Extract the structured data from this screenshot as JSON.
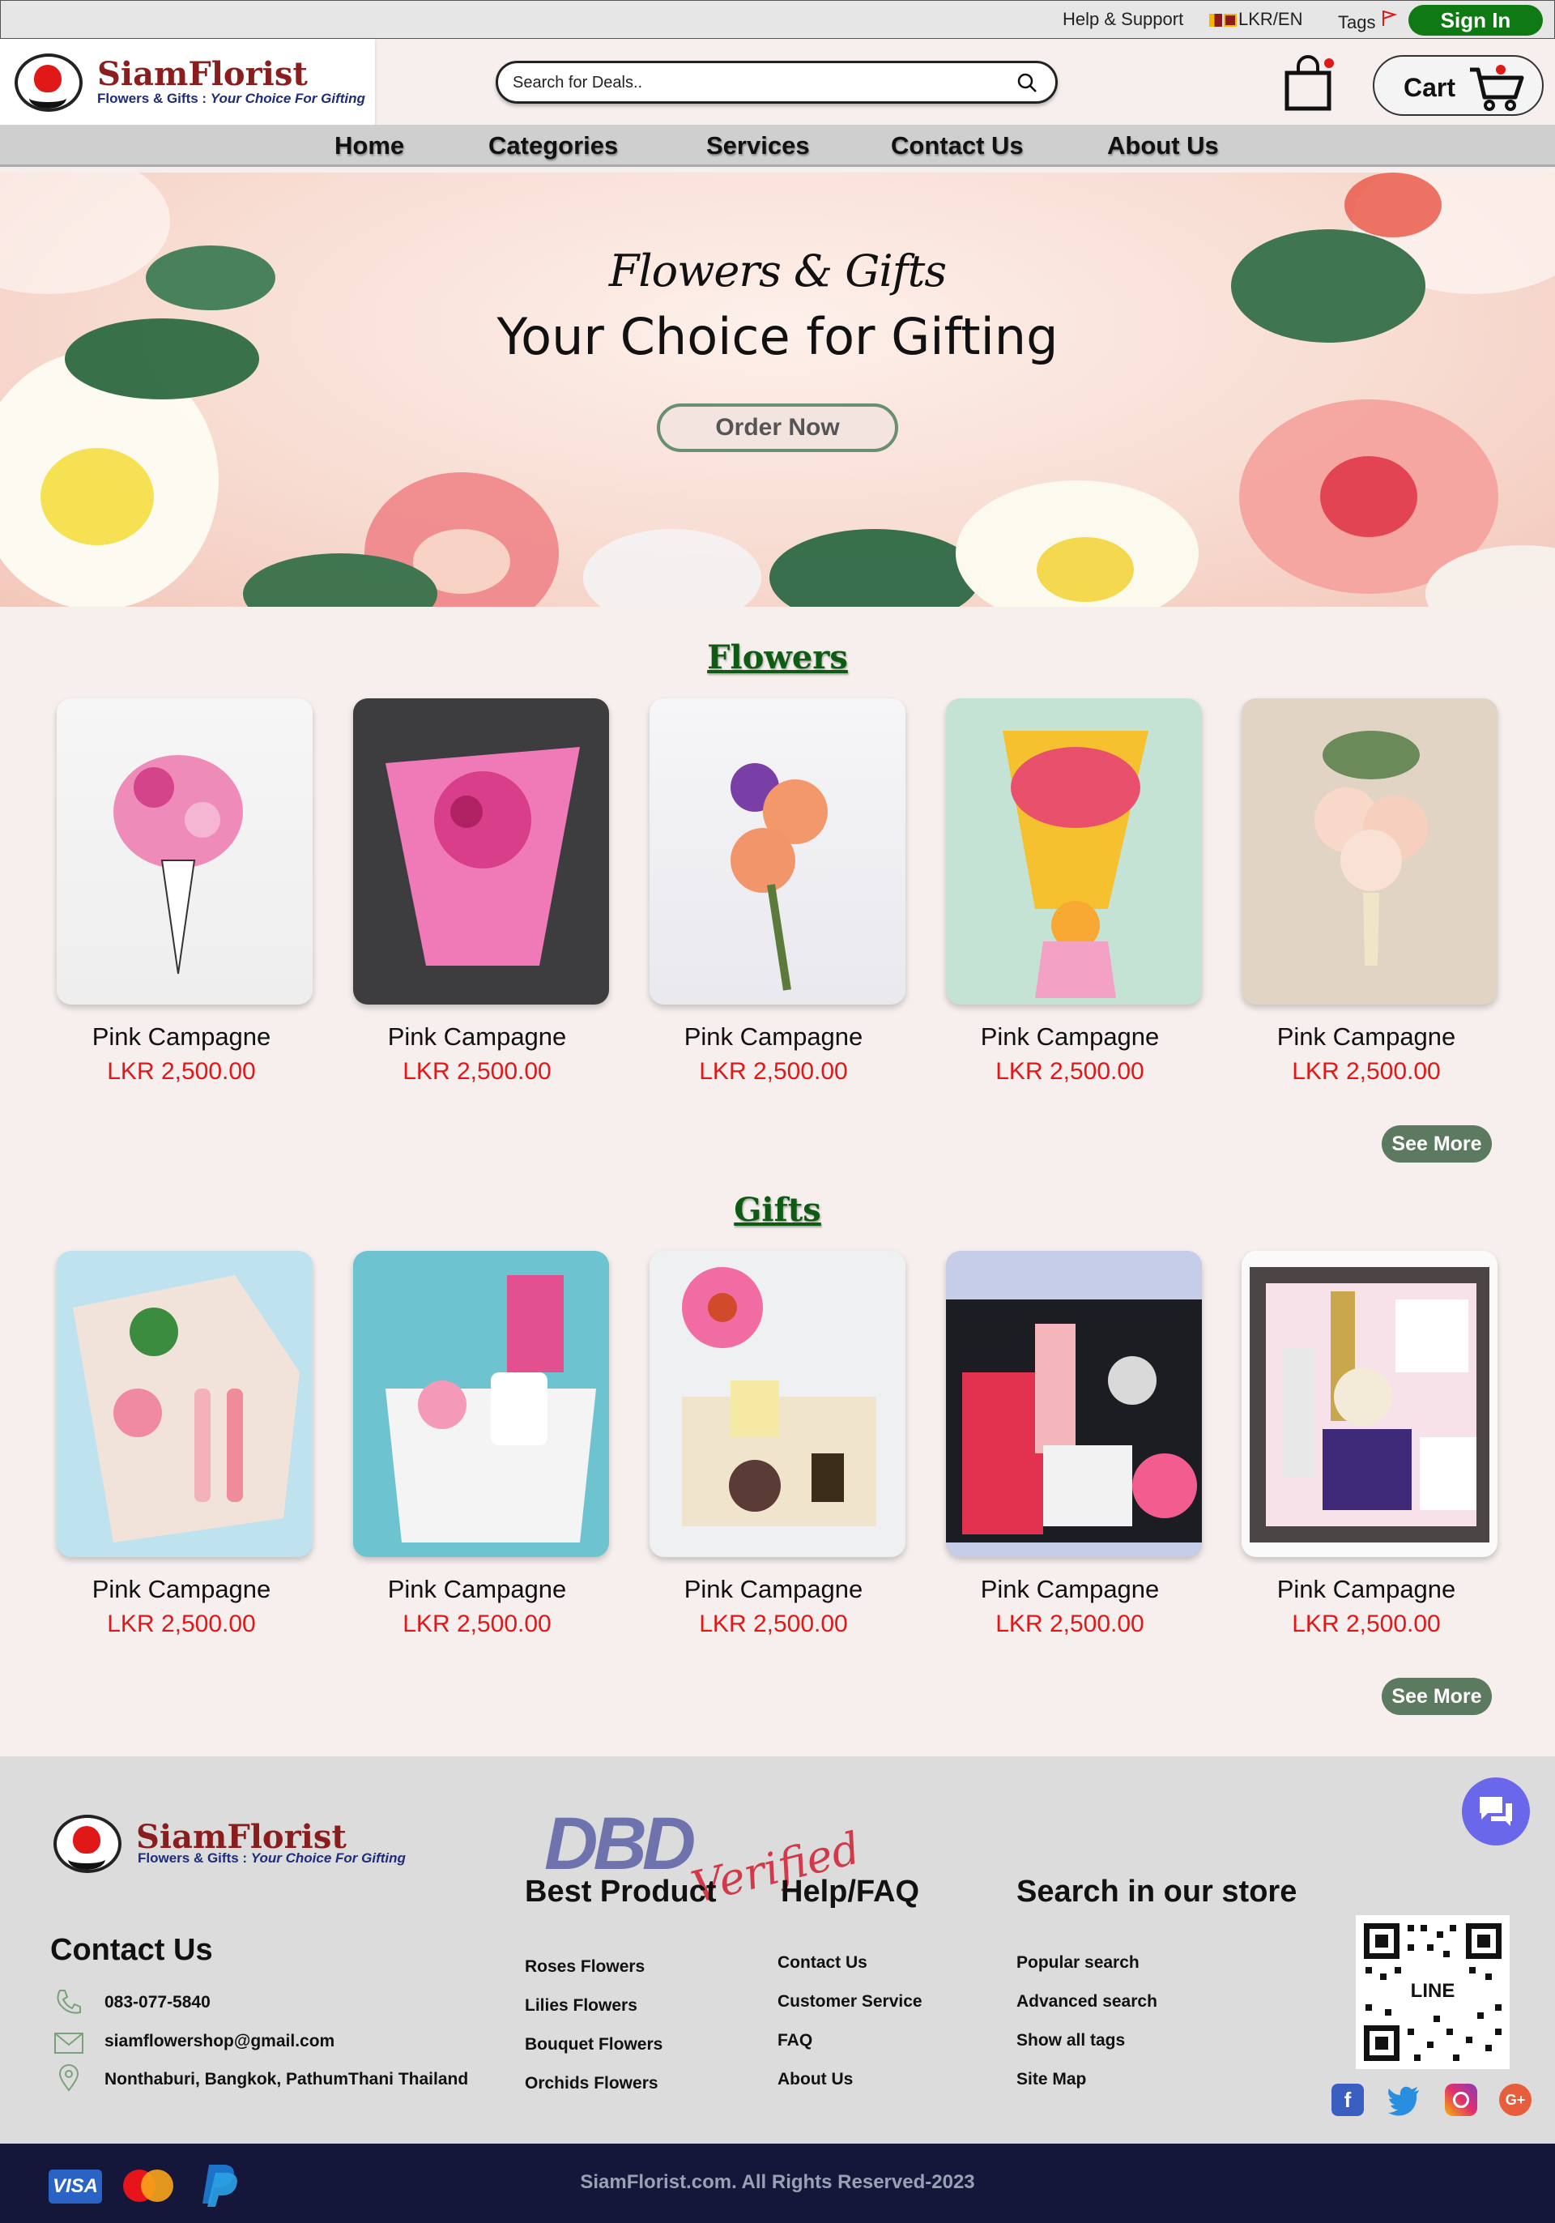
{
  "topbar": {
    "help": "Help & Support",
    "currency": "LKR/EN",
    "tags": "Tags",
    "signin": "Sign In"
  },
  "brand": {
    "name": "SiamFlorist",
    "tagline_prefix": "Flowers & Gifts : ",
    "tagline_italic": "Your Choice For Gifting"
  },
  "search": {
    "placeholder": "Search for Deals.."
  },
  "cart": {
    "label": "Cart"
  },
  "nav": [
    "Home",
    "Categories",
    "Services",
    "Contact Us",
    "About Us"
  ],
  "hero": {
    "kicker": "Flowers & Gifts",
    "title": "Your Choice for Gifting",
    "cta": "Order Now"
  },
  "flowers": {
    "title": "Flowers",
    "products": [
      {
        "name": "Pink Campagne",
        "price": "LKR 2,500.00"
      },
      {
        "name": "Pink Campagne",
        "price": "LKR 2,500.00"
      },
      {
        "name": "Pink Campagne",
        "price": "LKR 2,500.00"
      },
      {
        "name": "Pink Campagne",
        "price": "LKR 2,500.00"
      },
      {
        "name": "Pink Campagne",
        "price": "LKR 2,500.00"
      }
    ],
    "see_more": "See More"
  },
  "gifts": {
    "title": "Gifts",
    "products": [
      {
        "name": "Pink Campagne",
        "price": "LKR 2,500.00"
      },
      {
        "name": "Pink Campagne",
        "price": "LKR 2,500.00"
      },
      {
        "name": "Pink Campagne",
        "price": "LKR 2,500.00"
      },
      {
        "name": "Pink Campagne",
        "price": "LKR 2,500.00"
      },
      {
        "name": "Pink Campagne",
        "price": "LKR 2,500.00"
      }
    ],
    "see_more": "See More"
  },
  "footer": {
    "contact": {
      "title": "Contact Us",
      "phone": "083-077-5840",
      "email": "siamflowershop@gmail.com",
      "address": "Nonthaburi, Bangkok, PathumThani Thailand"
    },
    "dbd": {
      "logo": "DBD",
      "script": "Verified"
    },
    "best_product": {
      "title": "Best Product",
      "links": [
        "Roses Flowers",
        "Lilies Flowers",
        "Bouquet Flowers",
        "Orchids Flowers"
      ]
    },
    "help": {
      "title": "Help/FAQ",
      "links": [
        "Contact Us",
        "Customer Service",
        "FAQ",
        "About Us"
      ]
    },
    "store": {
      "title": "Search in our store",
      "links": [
        "Popular search",
        "Advanced search",
        "Show all tags",
        "Site Map"
      ]
    },
    "qr_label": "LINE",
    "social": {
      "facebook": "f",
      "google": "G+"
    },
    "payments": {
      "visa": "VISA"
    },
    "copyright": "SiamFlorist.com. All Rights Reserved-2023"
  },
  "colors": {
    "brand_green": "#0f7a14",
    "section_title": "#0e5c13",
    "price_red": "#e01818",
    "see_more": "#5c7a5f",
    "footer_bg": "#dcdcdc",
    "bottom_bar": "#14163a"
  },
  "icons": [
    "search-icon",
    "shopping-bag-icon",
    "cart-icon",
    "phone-icon",
    "mail-icon",
    "location-pin-icon",
    "chat-icon",
    "facebook-icon",
    "twitter-icon",
    "instagram-icon",
    "google-plus-icon",
    "visa-icon",
    "mastercard-icon",
    "paypal-icon",
    "qr-code"
  ]
}
